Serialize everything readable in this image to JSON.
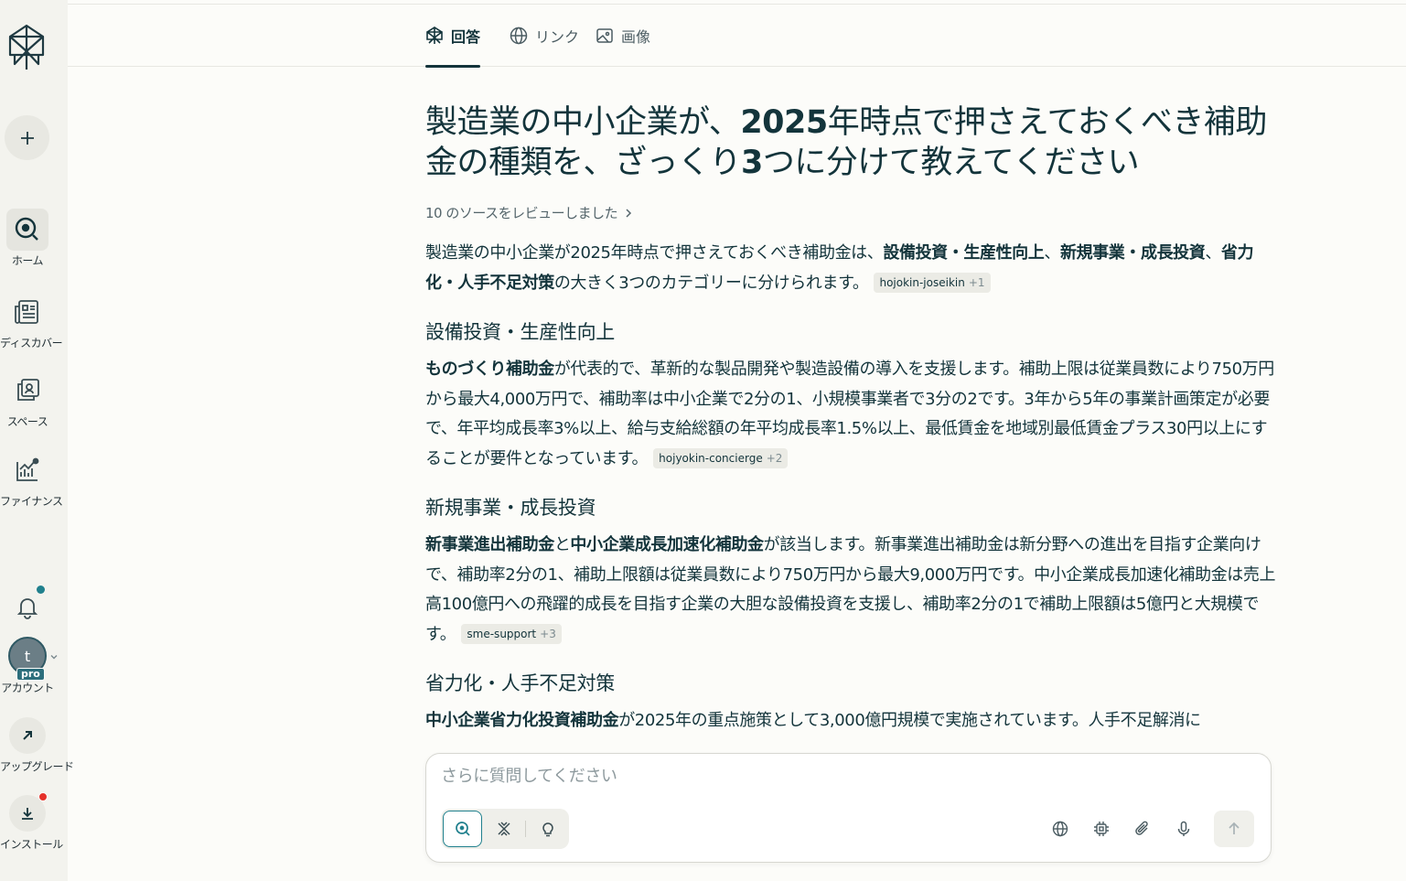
{
  "sidebar": {
    "logo_icon": "perplexity-logo-icon",
    "new_icon": "plus-icon",
    "items": [
      {
        "label": "ホーム",
        "icon": "search-home-icon",
        "active": true
      },
      {
        "label": "ディスカバー",
        "icon": "newspaper-icon"
      },
      {
        "label": "スペース",
        "icon": "spaces-icon"
      },
      {
        "label": "ファイナンス",
        "icon": "finance-chart-icon"
      }
    ],
    "notification_icon": "bell-icon",
    "account": {
      "initial": "t",
      "badge": "pro",
      "label": "アカウント"
    },
    "upgrade_label": "アップグレード",
    "install_label": "インストール"
  },
  "tabs": [
    {
      "label": "回答",
      "icon": "perplexity-icon",
      "active": true
    },
    {
      "label": "リンク",
      "icon": "globe-icon"
    },
    {
      "label": "画像",
      "icon": "image-icon"
    }
  ],
  "main": {
    "question_a": "製造業の中小企業が、",
    "question_b": "2025",
    "question_c": "年時点で押さえておくべき補助金の種類を、ざっくり",
    "question_d": "3",
    "question_e": "つに分けて教えてください",
    "sources_label": "10 のソースをレビューしました",
    "intro_a": "製造業の中小企業が2025年時点で押さえておくべき補助金は、",
    "intro_b1": "設備投資・生産性向上",
    "intro_c": "、",
    "intro_b2": "新規事業・成長投資",
    "intro_d": "、",
    "intro_b3": "省力化・人手不足対策",
    "intro_e": "の大きく3つのカテゴリーに分けられます。",
    "intro_cite": {
      "name": "hojokin-joseikin",
      "more": "+1"
    },
    "s1_heading": "設備投資・生産性向上",
    "s1_bold": "ものづくり補助金",
    "s1_text": "が代表的で、革新的な製品開発や製造設備の導入を支援します。補助上限は従業員数により750万円から最大4,000万円で、補助率は中小企業で2分の1、小規模事業者で3分の2です。3年から5年の事業計画策定が必要で、年平均成長率3%以上、給与支給総額の年平均成長率1.5%以上、最低賃金を地域別最低賃金プラス30円以上にすることが要件となっています。",
    "s1_cite": {
      "name": "hojyokin-concierge",
      "more": "+2"
    },
    "s2_heading": "新規事業・成長投資",
    "s2_bold1": "新事業進出補助金",
    "s2_mid": "と",
    "s2_bold2": "中小企業成長加速化補助金",
    "s2_text": "が該当します。新事業進出補助金は新分野への進出を目指す企業向けで、補助率2分の1、補助上限額は従業員数により750万円から最大9,000万円です。中小企業成長加速化補助金は売上高100億円への飛躍的成長を目指す企業の大胆な設備投資を支援し、補助率2分の1で補助上限額は5億円と大規模です。",
    "s2_cite": {
      "name": "sme-support",
      "more": "+3"
    },
    "s3_heading": "省力化・人手不足対策",
    "s3_bold": "中小企業省力化投資補助金",
    "s3_text": "が2025年の重点施策として3,000億円規模で実施されています。人手不足解消に"
  },
  "input": {
    "placeholder": "さらに質問してください",
    "modes": [
      "search-icon",
      "research-icon",
      "lightbulb-icon"
    ],
    "tools": [
      "globe-icon",
      "chip-icon",
      "paperclip-icon",
      "microphone-icon"
    ],
    "submit_icon": "arrow-up-icon"
  },
  "colors": {
    "accent": "#20808d",
    "text": "#13343b",
    "background": "#fcfcf9",
    "sidebar": "#f3f3ee"
  }
}
